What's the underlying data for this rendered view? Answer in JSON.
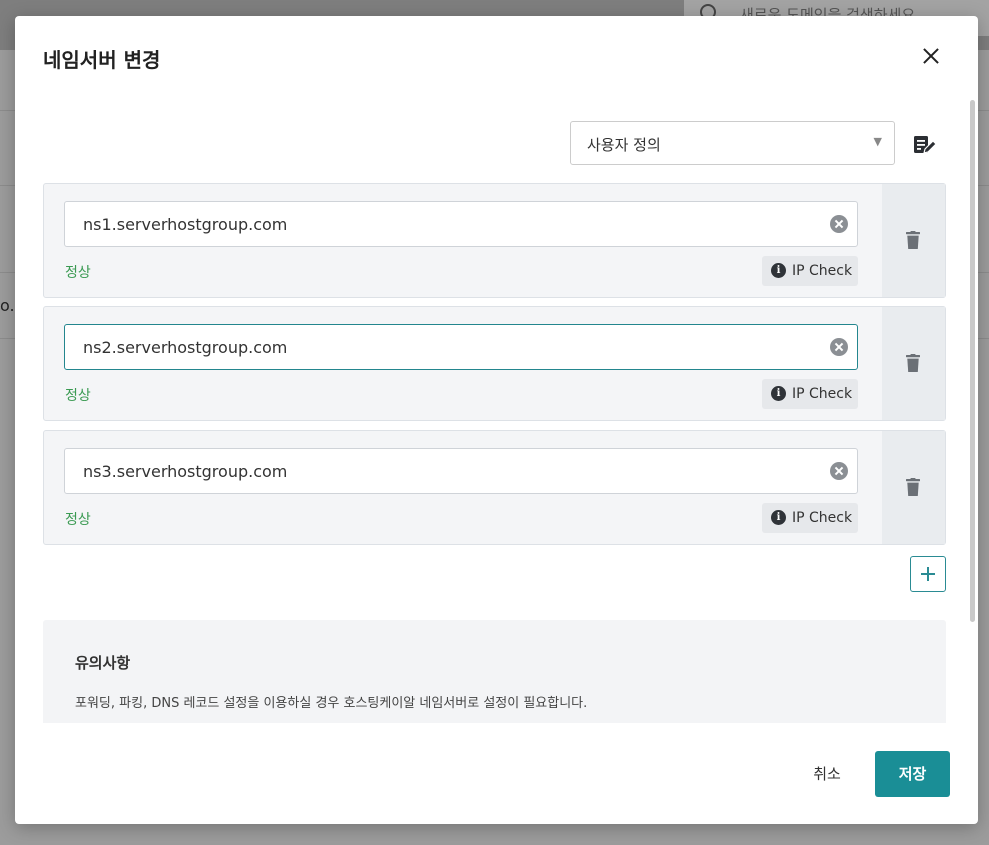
{
  "background": {
    "search_placeholder": "새로운 도메인을 검색하세요",
    "edge_text": "o.k"
  },
  "modal": {
    "title": "네임서버 변경",
    "preset_select": {
      "selected": "사용자 정의"
    },
    "nameservers": [
      {
        "value": "ns1.serverhostgroup.com",
        "status": "정상",
        "ip_check_label": "IP Check",
        "focused": false
      },
      {
        "value": "ns2.serverhostgroup.com",
        "status": "정상",
        "ip_check_label": "IP Check",
        "focused": true
      },
      {
        "value": "ns3.serverhostgroup.com",
        "status": "정상",
        "ip_check_label": "IP Check",
        "focused": false
      }
    ],
    "notice": {
      "title": "유의사항",
      "text": "포워딩, 파킹, DNS 레코드 설정을 이용하실 경우 호스팅케이알 네임서버로 설정이 필요합니다."
    },
    "buttons": {
      "cancel": "취소",
      "save": "저장"
    }
  },
  "colors": {
    "accent": "#1a8e96",
    "status_ok": "#3a9a52",
    "focus_border": "#23868e"
  },
  "icons": [
    "search-icon",
    "close-icon",
    "edit-icon",
    "clear-icon",
    "info-icon",
    "trash-icon",
    "plus-icon"
  ]
}
